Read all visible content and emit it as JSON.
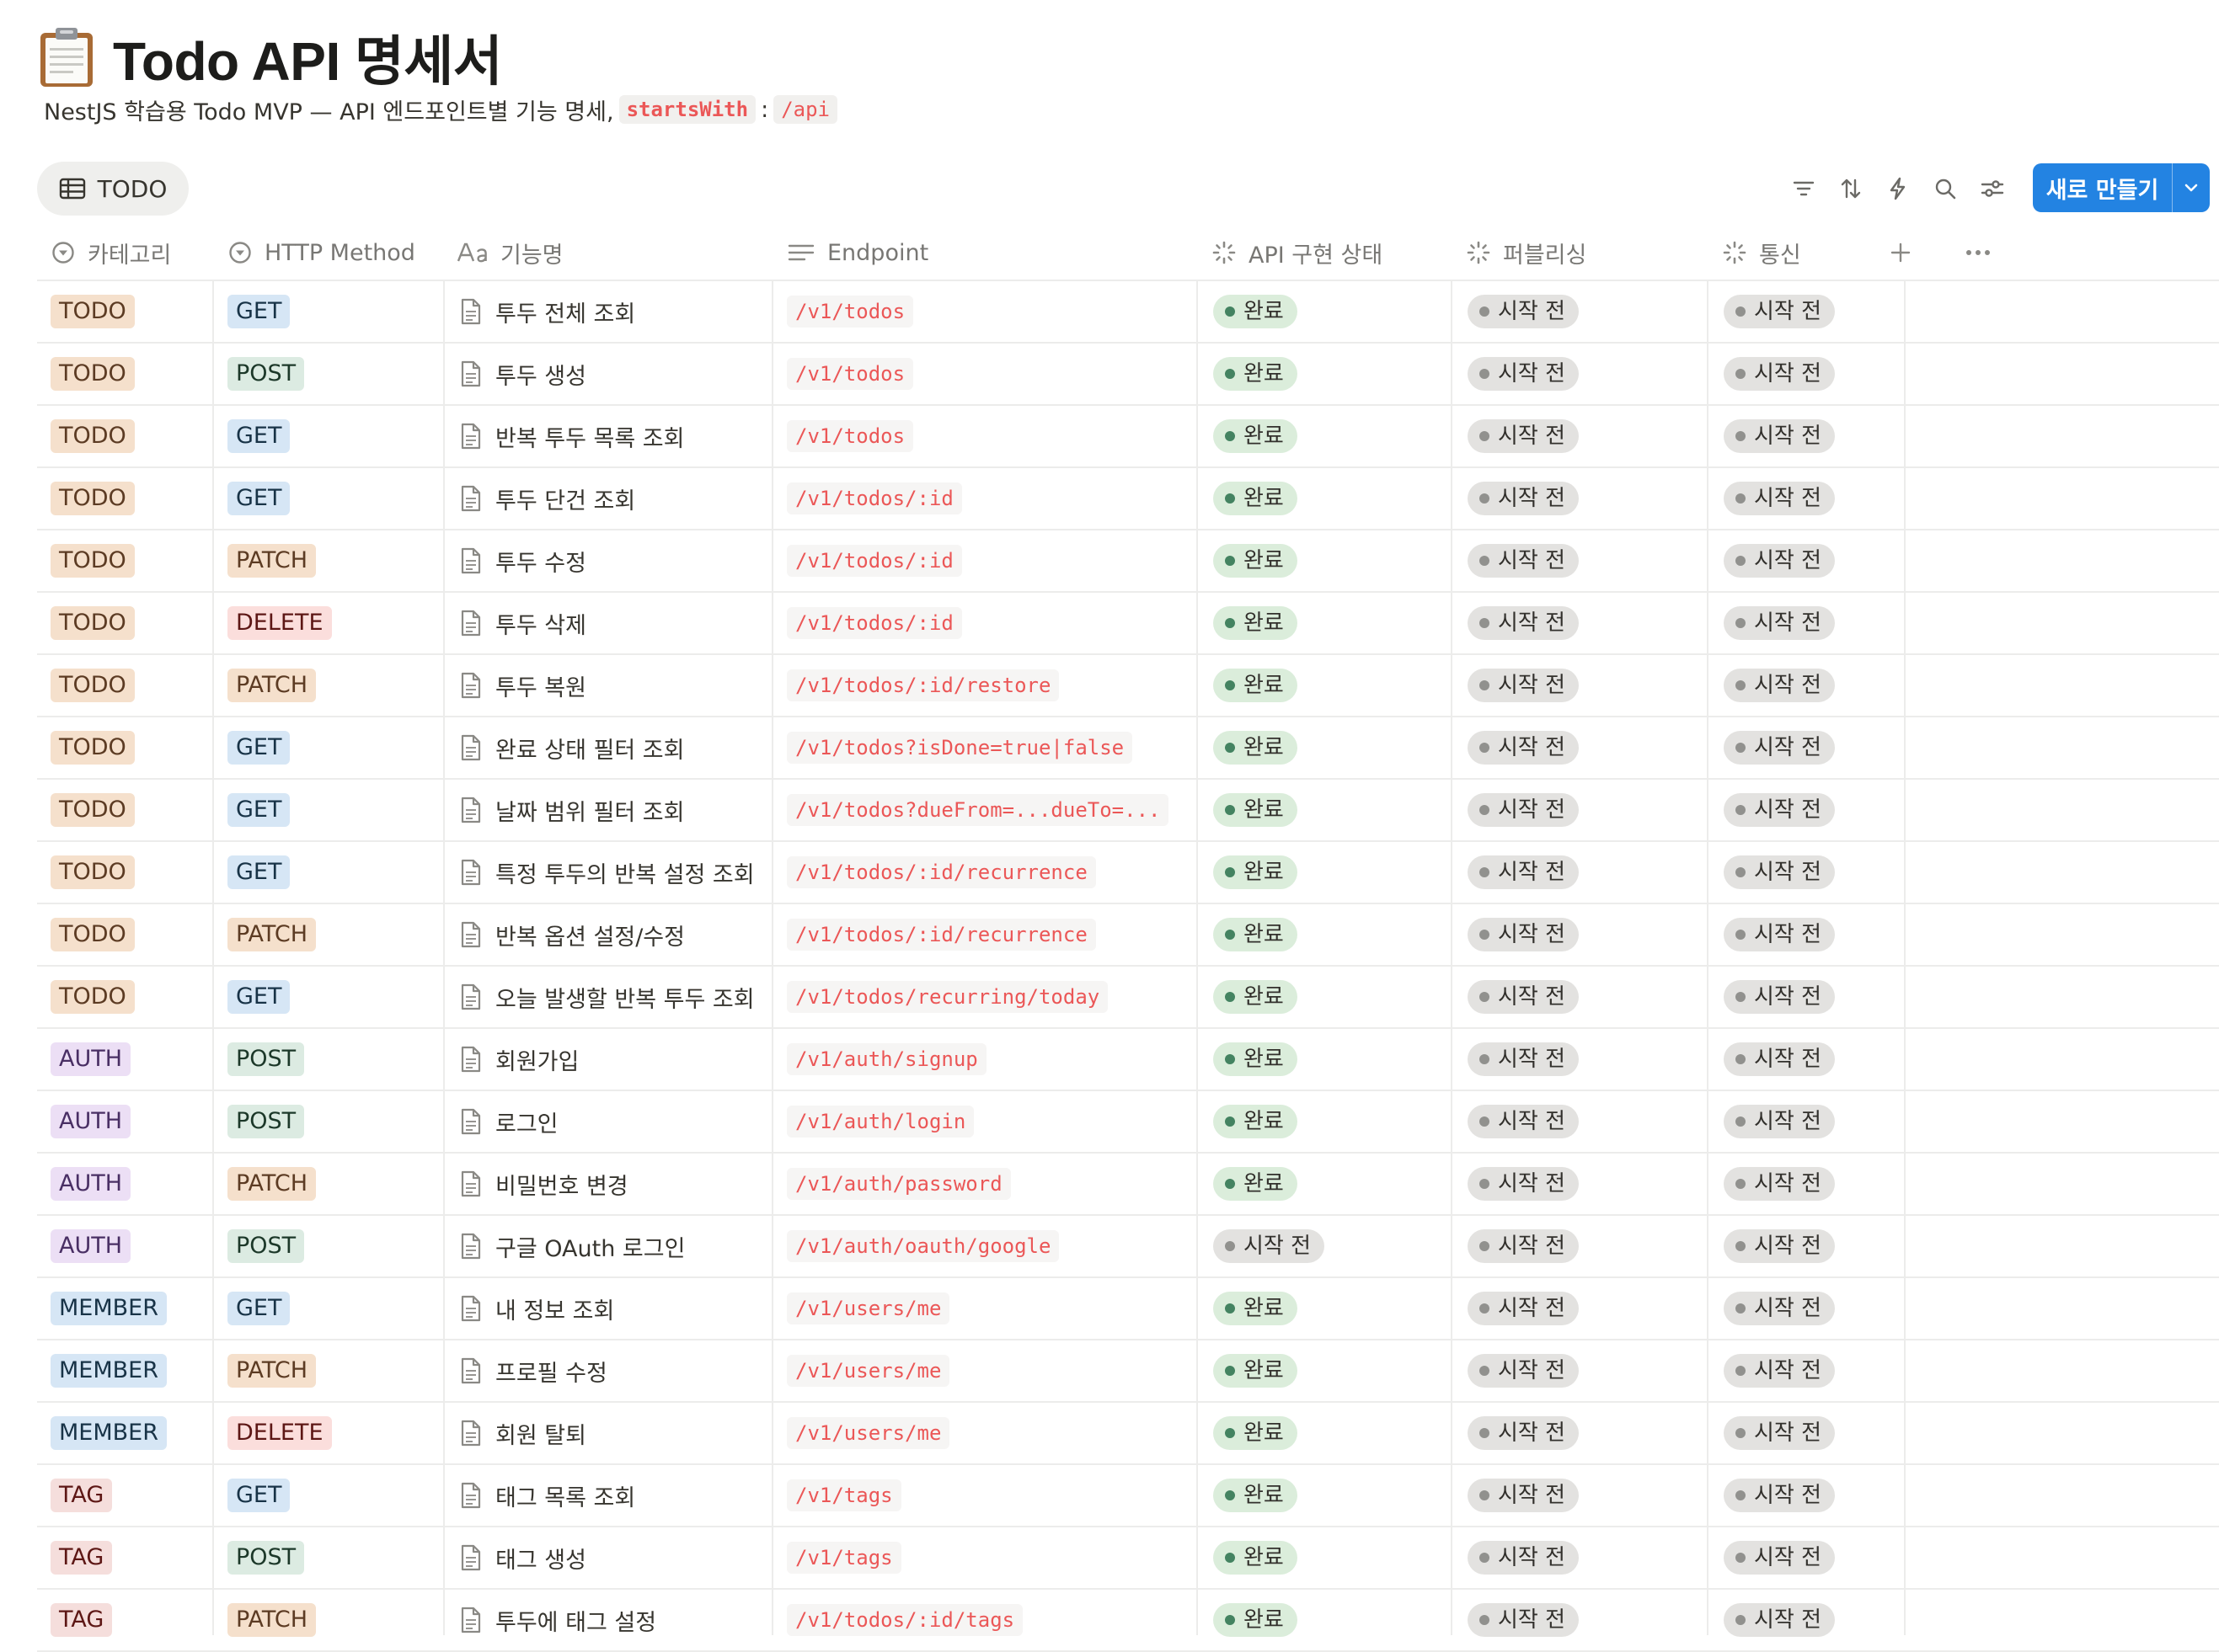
{
  "page": {
    "title": "Todo API 명세서",
    "subtitle_text": "NestJS 학습용 Todo MVP — API 엔드포인트별 기능 명세,",
    "subtitle_code1": "startsWith",
    "subtitle_colon": ":",
    "subtitle_code2": "/api",
    "icon": "clipboard-icon"
  },
  "toolbar": {
    "view_tab_label": "TODO",
    "view_tab_icon": "table-icon",
    "icons": [
      "filter-icon",
      "sort-icon",
      "lightning-icon",
      "search-icon",
      "settings-sliders-icon"
    ],
    "new_button_label": "새로 만들기"
  },
  "columns": [
    {
      "label": "카테고리",
      "icon": "select-icon"
    },
    {
      "label": "HTTP Method",
      "icon": "select-icon"
    },
    {
      "label": "기능명",
      "icon": "title-icon"
    },
    {
      "label": "Endpoint",
      "icon": "text-icon"
    },
    {
      "label": "API 구현 상태",
      "icon": "status-icon"
    },
    {
      "label": "퍼블리싱",
      "icon": "status-icon"
    },
    {
      "label": "통신",
      "icon": "status-icon"
    }
  ],
  "colors": {
    "accent": "#2383e2",
    "endpoint_text": "#eb5757",
    "category": {
      "TODO": {
        "bg": "#f5e0cc",
        "fg": "#5c3b23"
      },
      "AUTH": {
        "bg": "#ecdff5",
        "fg": "#492f64"
      },
      "MEMBER": {
        "bg": "#d6e6f5",
        "fg": "#183347"
      },
      "TAG": {
        "bg": "#f5dedc",
        "fg": "#5d1715"
      }
    },
    "method": {
      "GET": {
        "bg": "#d6e6f5",
        "fg": "#183347"
      },
      "POST": {
        "bg": "#dcebe2",
        "fg": "#1c3829"
      },
      "PATCH": {
        "bg": "#f5e0cc",
        "fg": "#5c3b23"
      },
      "DELETE": {
        "bg": "#fbdedc",
        "fg": "#5d1715"
      }
    },
    "status": {
      "완료": {
        "bg": "#dbeddb",
        "dot": "#448361"
      },
      "시작 전": {
        "bg": "#e3e2e0",
        "dot": "#91918e"
      }
    }
  },
  "rows": [
    {
      "category": "TODO",
      "method": "GET",
      "name": "투두 전체 조회",
      "endpoint": "/v1/todos",
      "api_status": "완료",
      "publishing": "시작 전",
      "communication": "시작 전"
    },
    {
      "category": "TODO",
      "method": "POST",
      "name": "투두 생성",
      "endpoint": "/v1/todos",
      "api_status": "완료",
      "publishing": "시작 전",
      "communication": "시작 전"
    },
    {
      "category": "TODO",
      "method": "GET",
      "name": "반복 투두 목록 조회",
      "endpoint": "/v1/todos",
      "api_status": "완료",
      "publishing": "시작 전",
      "communication": "시작 전"
    },
    {
      "category": "TODO",
      "method": "GET",
      "name": "투두 단건 조회",
      "endpoint": "/v1/todos/:id",
      "api_status": "완료",
      "publishing": "시작 전",
      "communication": "시작 전"
    },
    {
      "category": "TODO",
      "method": "PATCH",
      "name": "투두 수정",
      "endpoint": "/v1/todos/:id",
      "api_status": "완료",
      "publishing": "시작 전",
      "communication": "시작 전"
    },
    {
      "category": "TODO",
      "method": "DELETE",
      "name": "투두 삭제",
      "endpoint": "/v1/todos/:id",
      "api_status": "완료",
      "publishing": "시작 전",
      "communication": "시작 전"
    },
    {
      "category": "TODO",
      "method": "PATCH",
      "name": "투두 복원",
      "endpoint": "/v1/todos/:id/restore",
      "api_status": "완료",
      "publishing": "시작 전",
      "communication": "시작 전"
    },
    {
      "category": "TODO",
      "method": "GET",
      "name": "완료 상태 필터 조회",
      "endpoint": "/v1/todos?isDone=true|false",
      "api_status": "완료",
      "publishing": "시작 전",
      "communication": "시작 전"
    },
    {
      "category": "TODO",
      "method": "GET",
      "name": "날짜 범위 필터 조회",
      "endpoint": "/v1/todos?dueFrom=...dueTo=...",
      "api_status": "완료",
      "publishing": "시작 전",
      "communication": "시작 전"
    },
    {
      "category": "TODO",
      "method": "GET",
      "name": "특정 투두의 반복 설정 조회",
      "endpoint": "/v1/todos/:id/recurrence",
      "api_status": "완료",
      "publishing": "시작 전",
      "communication": "시작 전"
    },
    {
      "category": "TODO",
      "method": "PATCH",
      "name": "반복 옵션 설정/수정",
      "endpoint": "/v1/todos/:id/recurrence",
      "api_status": "완료",
      "publishing": "시작 전",
      "communication": "시작 전"
    },
    {
      "category": "TODO",
      "method": "GET",
      "name": "오늘 발생할 반복 투두 조회",
      "endpoint": "/v1/todos/recurring/today",
      "api_status": "완료",
      "publishing": "시작 전",
      "communication": "시작 전"
    },
    {
      "category": "AUTH",
      "method": "POST",
      "name": "회원가입",
      "endpoint": "/v1/auth/signup",
      "api_status": "완료",
      "publishing": "시작 전",
      "communication": "시작 전"
    },
    {
      "category": "AUTH",
      "method": "POST",
      "name": "로그인",
      "endpoint": "/v1/auth/login",
      "api_status": "완료",
      "publishing": "시작 전",
      "communication": "시작 전"
    },
    {
      "category": "AUTH",
      "method": "PATCH",
      "name": "비밀번호 변경",
      "endpoint": "/v1/auth/password",
      "api_status": "완료",
      "publishing": "시작 전",
      "communication": "시작 전"
    },
    {
      "category": "AUTH",
      "method": "POST",
      "name": "구글 OAuth 로그인",
      "endpoint": "/v1/auth/oauth/google",
      "api_status": "시작 전",
      "publishing": "시작 전",
      "communication": "시작 전"
    },
    {
      "category": "MEMBER",
      "method": "GET",
      "name": "내 정보 조회",
      "endpoint": "/v1/users/me",
      "api_status": "완료",
      "publishing": "시작 전",
      "communication": "시작 전"
    },
    {
      "category": "MEMBER",
      "method": "PATCH",
      "name": "프로필 수정",
      "endpoint": "/v1/users/me",
      "api_status": "완료",
      "publishing": "시작 전",
      "communication": "시작 전"
    },
    {
      "category": "MEMBER",
      "method": "DELETE",
      "name": "회원 탈퇴",
      "endpoint": "/v1/users/me",
      "api_status": "완료",
      "publishing": "시작 전",
      "communication": "시작 전"
    },
    {
      "category": "TAG",
      "method": "GET",
      "name": "태그 목록 조회",
      "endpoint": "/v1/tags",
      "api_status": "완료",
      "publishing": "시작 전",
      "communication": "시작 전"
    },
    {
      "category": "TAG",
      "method": "POST",
      "name": "태그 생성",
      "endpoint": "/v1/tags",
      "api_status": "완료",
      "publishing": "시작 전",
      "communication": "시작 전"
    },
    {
      "category": "TAG",
      "method": "PATCH",
      "name": "투두에 태그 설정",
      "endpoint": "/v1/todos/:id/tags",
      "api_status": "완료",
      "publishing": "시작 전",
      "communication": "시작 전"
    }
  ]
}
